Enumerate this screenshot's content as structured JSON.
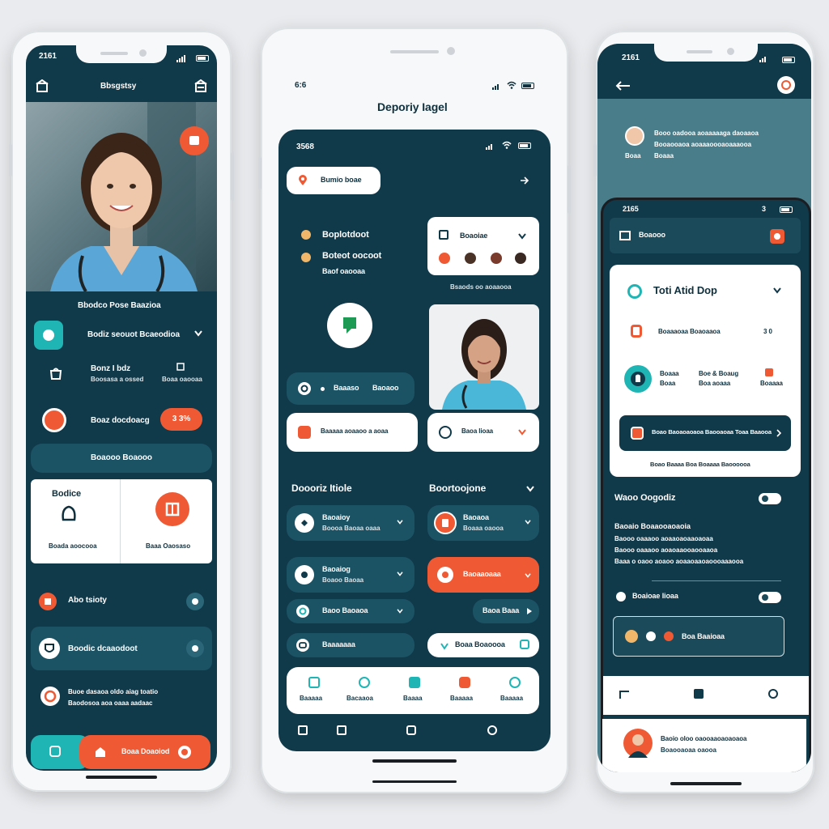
{
  "colors": {
    "dark_teal": "#10394a",
    "card_teal": "#1b5264",
    "accent_orange": "#ef5a34",
    "accent_teal": "#1fb5b5",
    "background": "#e9ebee"
  },
  "left_phone": {
    "status_time": "2161",
    "header_title": "Bbsgstsy",
    "hero_title": "Bbodco Pose Baazioa",
    "row1_label": "Bodiz seouot Bcaeodioa",
    "row2_title": "Bonz I bdz",
    "row2_sub": "Boosasa a ossed",
    "row2_right": "Boaa oaooaa",
    "row3_label": "Boaz docdoacg",
    "row3_badge": "3 3%",
    "wide_button": "Boaooo Boaooo",
    "card_left_title": "Bodice",
    "card_left_sub": "Boada aoocooa",
    "card_right_sub": "Baaa Oaosaso",
    "list1": "Abo tsioty",
    "list2": "Boodic dcaaodoot",
    "list3_line1": "Buoe dasaoa oldo aiag toatio",
    "list3_line2": "Baodosoa aoa oaaa aadaac",
    "bottom_button": "Boaa Doaoiod"
  },
  "center_phone": {
    "status_time": "6:6",
    "page_title": "Deporiy Iagel",
    "inner_time": "3568",
    "search_pill": "Bumio boae",
    "feature1": "Boplotdoot",
    "feature2": "Boteot oocoot",
    "feature2_sub": "Baof oaooaa",
    "card_title": "Boaoiae",
    "card_caption": "Bsaods oo aoaaooa",
    "row_a_left": "Baaaso",
    "row_a_right": "Baoaoo",
    "row_b": "Baaaaa aoaaoo a aoaa",
    "row_b_right": "Baoa lioaa",
    "section_left": "Doooriz Itiole",
    "section_right": "Boortoojone",
    "list_left": [
      {
        "title": "Baoaioy",
        "sub": "Boooa Baoaa oaaa"
      },
      {
        "title": "Baoaiog",
        "sub": "Boaoo Baoaa"
      },
      {
        "title": "Baoo Baoaoa",
        "sub": ""
      },
      {
        "title": "Baaaaaaa",
        "sub": ""
      }
    ],
    "list_right": [
      {
        "title": "Baoaoa",
        "sub": "Boaaa oaooa"
      },
      {
        "title": "Baoaaoaaa",
        "sub": ""
      },
      {
        "title": "Baoa Baaa",
        "sub": ""
      },
      {
        "title": "Boaa Boaoooa",
        "sub": ""
      }
    ],
    "tabs": [
      "Baaaaa",
      "Bacaaoa",
      "Baaaa",
      "Baaaaa",
      "Baaaaa"
    ]
  },
  "right_phone": {
    "status_time": "2161",
    "profile_line1": "Booo oadooa aoaaaaaga daoaaoa",
    "profile_line2": "Booaooaoa aoaaaoooaoaaaooa",
    "profile_line3": "Boaaa",
    "inner_time": "2165",
    "inner_right": "3",
    "inner_header": "Boaooo",
    "card_title": "Toti Atid Dop",
    "row1": "Boaaaoaa Boaoaaoa",
    "row1_right": "3 0",
    "row2_left": "Boaaa",
    "row2_left_sub": "Boaa",
    "row2_mid": "Boe & Boaug",
    "row2_mid_sub": "Boa aoaaa",
    "row2_right": "Boaaaa",
    "banner": "Boao Baoaoaoaoa Baooaoaa Toaa Baaooa",
    "banner_caption": "Boao Baaaa Boa Boaaaa Baoooooa",
    "section_title": "Waoo Oogodiz",
    "section_line1": "Baoaio Boaaooaoaoia",
    "section_line2": "Baooo oaaaoo aoaaoaoaaoaoaa",
    "section_line3": "Baooo oaaaoo aoaoaaooaooaaoa",
    "section_line4": "Baaa o oaoo aoaoo aoaaoaaoaoooaaaooa",
    "toggle_label": "Boaioae lioaa",
    "outline_button": "Boa Baaioaa",
    "footer_line1": "Baoio oloo oaooaaoaoaoaoa",
    "footer_line2": "Boaooaoaa oaooa"
  }
}
